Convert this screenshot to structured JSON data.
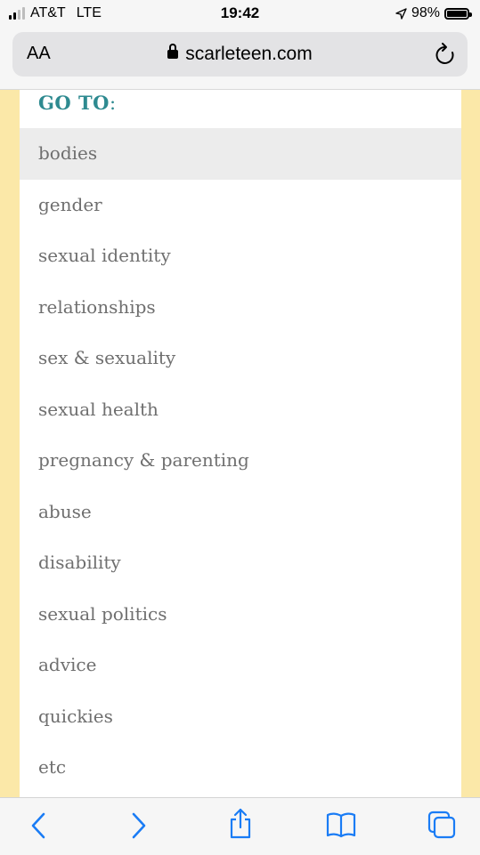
{
  "status_bar": {
    "carrier": "AT&T",
    "network": "LTE",
    "time": "19:42",
    "battery": "98%",
    "battery_level": 0.98
  },
  "address_bar": {
    "text_size_label": "AA",
    "url": "scarleteen.com"
  },
  "menu": {
    "heading": "GO TO",
    "heading_suffix": ":",
    "items": [
      {
        "label": "bodies",
        "active": true
      },
      {
        "label": "gender"
      },
      {
        "label": "sexual identity"
      },
      {
        "label": "relationships"
      },
      {
        "label": "sex & sexuality"
      },
      {
        "label": "sexual health"
      },
      {
        "label": "pregnancy & parenting"
      },
      {
        "label": "abuse"
      },
      {
        "label": "disability"
      },
      {
        "label": "sexual politics"
      },
      {
        "label": "advice"
      },
      {
        "label": "quickies"
      },
      {
        "label": "etc"
      }
    ]
  },
  "toolbar": {
    "icons": [
      "back-icon",
      "forward-icon",
      "share-icon",
      "bookmarks-icon",
      "tabs-icon"
    ]
  },
  "colors": {
    "accent": "#2e8a90",
    "page_background": "#fbe8a8",
    "safari_blue": "#1a7cf5"
  }
}
